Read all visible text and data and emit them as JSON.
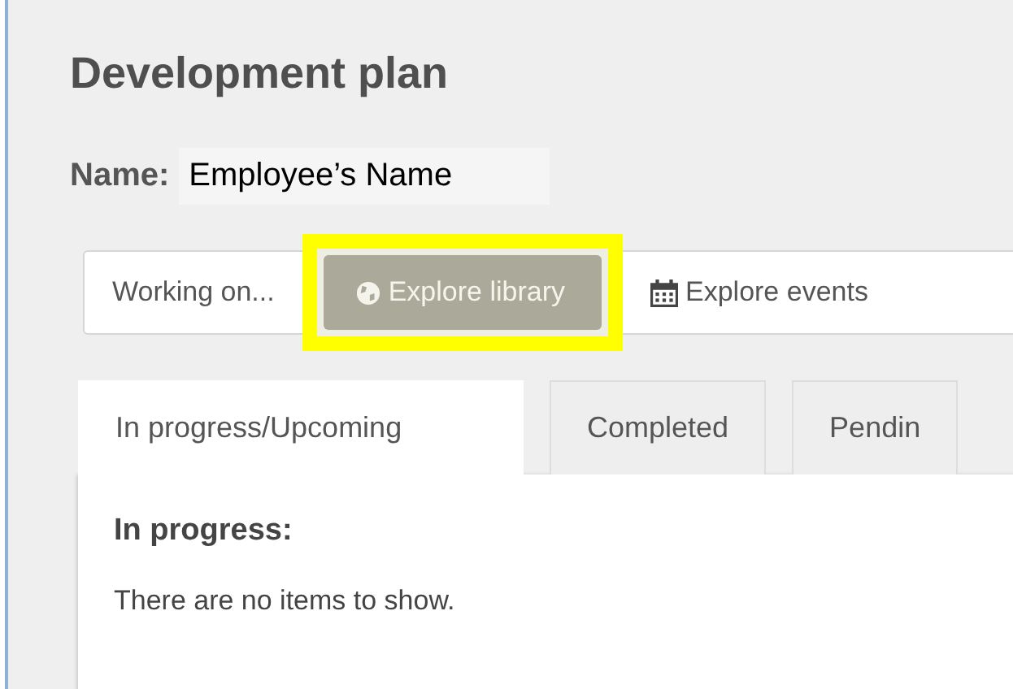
{
  "title": "Development plan",
  "name_field": {
    "label": "Name:",
    "value": "Employee’s Name"
  },
  "actions": [
    {
      "label": "Working on...",
      "selected": false,
      "highlighted": false
    },
    {
      "label": "Explore library",
      "selected": true,
      "highlighted": true
    },
    {
      "label": "Explore events",
      "selected": false,
      "highlighted": false
    }
  ],
  "tabs": [
    {
      "label": "In progress/Upcoming",
      "selected": true
    },
    {
      "label": "Completed",
      "selected": false
    },
    {
      "label": "Pendin",
      "selected": false
    }
  ],
  "panel": {
    "heading": "In progress:",
    "message": "There are no items to show."
  }
}
